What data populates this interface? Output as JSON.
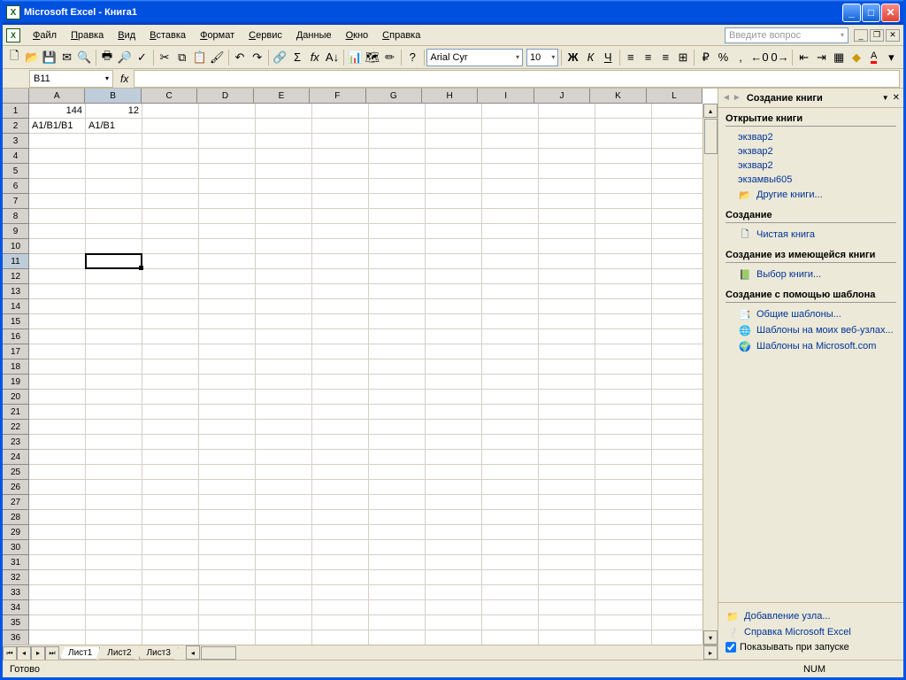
{
  "title": "Microsoft Excel - Книга1",
  "menus": [
    "Файл",
    "Правка",
    "Вид",
    "Вставка",
    "Формат",
    "Сервис",
    "Данные",
    "Окно",
    "Справка"
  ],
  "ask_placeholder": "Введите вопрос",
  "font": {
    "name": "Arial Cyr",
    "size": "10"
  },
  "name_box": "B11",
  "columns": [
    "A",
    "B",
    "C",
    "D",
    "E",
    "F",
    "G",
    "H",
    "I",
    "J",
    "K",
    "L"
  ],
  "sel": {
    "row": 11,
    "col": "B"
  },
  "cells": {
    "A1": "144",
    "B1": "12",
    "A2": "A1/B1/B1",
    "B2": "A1/B1"
  },
  "sheets": [
    "Лист1",
    "Лист2",
    "Лист3"
  ],
  "active_sheet": 0,
  "taskpane": {
    "title": "Создание книги",
    "open": {
      "label": "Открытие книги",
      "items": [
        "экзвар2",
        "экзвар2",
        "экзвар2",
        "экзамвы605"
      ],
      "more": "Другие книги..."
    },
    "create": {
      "label": "Создание",
      "blank": "Чистая книга"
    },
    "from_existing": {
      "label": "Создание из имеющейся книги",
      "choose": "Выбор книги..."
    },
    "template": {
      "label": "Создание с помощью шаблона",
      "items": [
        "Общие шаблоны...",
        "Шаблоны на моих веб-узлах...",
        "Шаблоны на Microsoft.com"
      ]
    },
    "footer": {
      "add": "Добавление узла...",
      "help": "Справка Microsoft Excel",
      "show": "Показывать при запуске"
    }
  },
  "status": {
    "ready": "Готово",
    "num": "NUM"
  }
}
